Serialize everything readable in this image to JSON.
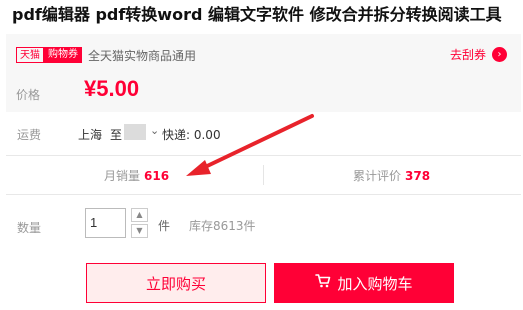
{
  "page_title": "pdf编辑器 pdf转换word 编辑文字软件 修改合并拆分转换阅读工具",
  "coupon": {
    "tag_store": "天猫",
    "tag_type": "购物券",
    "description": "全天猫实物商品通用",
    "get_link": "去刮券"
  },
  "price": {
    "label": "价格",
    "value": "¥5.00"
  },
  "shipping": {
    "label": "运费",
    "from": "上海",
    "to": "至",
    "express": "快递: 0.00"
  },
  "stats": {
    "monthly_sales_label": "月销量",
    "monthly_sales_value": "616",
    "reviews_label": "累计评价",
    "reviews_value": "378"
  },
  "quantity": {
    "label": "数量",
    "value": "1",
    "unit": "件",
    "stock": "库存8613件"
  },
  "buttons": {
    "buy_now": "立即购买",
    "add_to_cart": "加入购物车"
  },
  "colors": {
    "accent": "#ff0036",
    "annotation_arrow": "#e8232b"
  },
  "icons": {
    "cart": "shopping-cart-icon",
    "get_coupon": "chevron-right-circle-icon",
    "stepper_up": "triangle-up-icon",
    "stepper_down": "triangle-down-icon"
  }
}
